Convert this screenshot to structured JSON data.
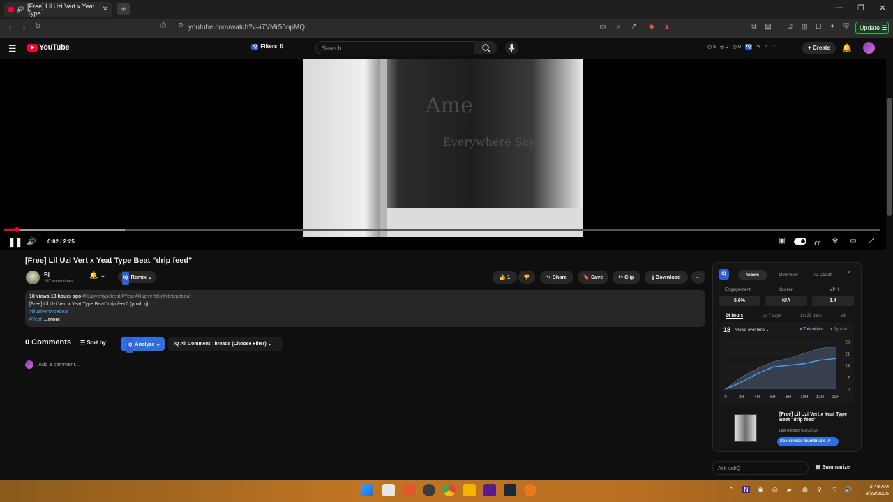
{
  "browser": {
    "tab_title": "[Free] Lil Uzi Vert x Yeat Type",
    "url": "youtube.com/watch?v=i7VMr55npMQ",
    "update_label": "Update"
  },
  "youtube": {
    "logo_text": "YouTube",
    "filters_label": "Filters",
    "search_placeholder": "Search",
    "header_stats": [
      "5",
      "0",
      "0"
    ],
    "create_label": "Create"
  },
  "video": {
    "time": "0:02 / 2:25",
    "progress_played_fraction": 0.014,
    "progress_buffered_fraction": 0.138,
    "title": "[Free] Lil Uzi Vert x Yeat Type Beat \"drip feed\"",
    "hoodie_text": "Ame",
    "hoodie_text2": "Everywhere Say"
  },
  "channel": {
    "name": "Rj",
    "subscribers": "287 subscribers"
  },
  "actions": {
    "remix": "Remix",
    "likes": "1",
    "share": "Share",
    "save": "Save",
    "clip": "Clip",
    "download": "Download"
  },
  "description": {
    "stats": "18 views  13 hours ago",
    "tags": "#liluzivertypebeat #Yeat #liluzivertallwhitetypebeat",
    "line2": "[Free] Lil Uzi Vert x Yeat Type Beat \"drip feed\" (prod. rj)",
    "line3": "#liluziverttypebeat",
    "line4": "#Yeat",
    "more": "...more"
  },
  "comments": {
    "count": "0 Comments",
    "sort_by": "Sort by",
    "analyze": "Analyze",
    "threads": "All Comment Threads (Choose Filter)",
    "add_placeholder": "Add a comment..."
  },
  "vidiq": {
    "logo": "IQ",
    "tabs": [
      "Views",
      "Overview",
      "AI Coach"
    ],
    "metrics": [
      {
        "label": "Engagement",
        "value": "5.6%"
      },
      {
        "label": "Outlier",
        "value": "N/A"
      },
      {
        "label": "VPH",
        "value": "1.4"
      }
    ],
    "ranges": [
      "24 hours",
      "1st 7 days",
      "1st 28 days",
      "All"
    ],
    "views_count": "18",
    "views_label": "Views over time",
    "legend_this": "This video",
    "legend_typical": "Typical",
    "video_title": "[Free] Lil Uzi Vert x Yeat Type Beat \"drip feed\"",
    "last_updated": "Last Updated 03/22/2026",
    "similar_btn": "See similar thumbnails",
    "ask_placeholder": "Ask vidIQ",
    "summarize": "Summarize"
  },
  "chart_data": {
    "type": "area",
    "x": [
      "0",
      "2H",
      "4H",
      "6H",
      "8H",
      "10H",
      "12H",
      "13H"
    ],
    "series": [
      {
        "name": "This video",
        "values": [
          0,
          4,
          9,
          13,
          14,
          15,
          17,
          18
        ]
      },
      {
        "name": "Typical",
        "values": [
          0,
          7,
          12,
          16,
          18,
          21,
          24,
          25
        ]
      }
    ],
    "yticks": [
      0,
      7,
      14,
      21,
      28
    ],
    "ylim": [
      0,
      28
    ],
    "colors": {
      "this_video": "#3ea6ff",
      "typical": "#5a6a8a"
    }
  },
  "taskbar": {
    "time": "2:49 AM",
    "date": "3/23/2026"
  }
}
